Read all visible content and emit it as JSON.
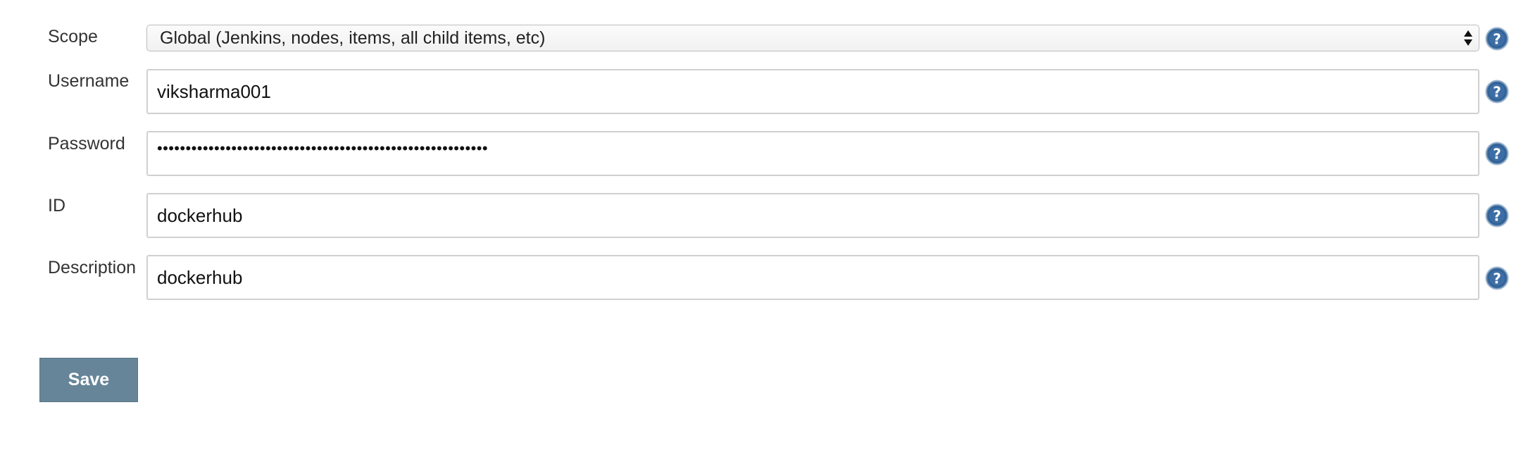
{
  "form": {
    "scope": {
      "label": "Scope",
      "value": "Global (Jenkins, nodes, items, all child items, etc)"
    },
    "username": {
      "label": "Username",
      "value": "viksharma001"
    },
    "password": {
      "label": "Password",
      "masked_value": "••••••••••••••••••••••••••••••••••••••••••••••••••••••••••"
    },
    "id": {
      "label": "ID",
      "value": "dockerhub"
    },
    "description": {
      "label": "Description",
      "value": "dockerhub"
    }
  },
  "actions": {
    "save_label": "Save"
  },
  "colors": {
    "save_button_bg": "#668599",
    "help_icon": "#3c6ea5",
    "field_border": "#d0d0d0"
  },
  "icons": {
    "help": "question-circle-icon",
    "select_arrows": "up-down-arrows-icon"
  }
}
